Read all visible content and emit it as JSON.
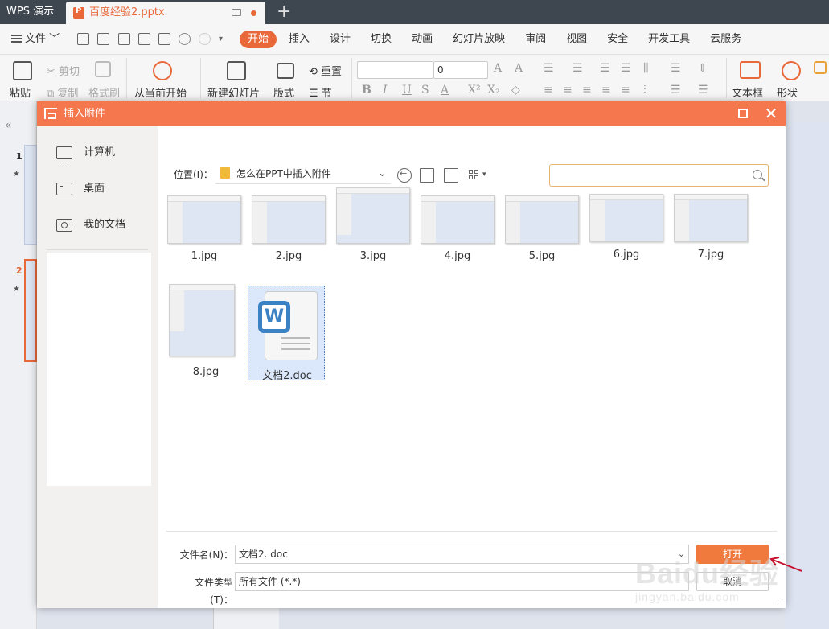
{
  "app": {
    "title": "WPS 演示",
    "doc_tab": "百度经验2.pptx"
  },
  "menu": {
    "file_label": "文件",
    "tabs": [
      {
        "label": "开始",
        "active": true
      },
      {
        "label": "插入"
      },
      {
        "label": "设计"
      },
      {
        "label": "切换"
      },
      {
        "label": "动画"
      },
      {
        "label": "幻灯片放映"
      },
      {
        "label": "审阅"
      },
      {
        "label": "视图"
      },
      {
        "label": "安全"
      },
      {
        "label": "开发工具"
      },
      {
        "label": "云服务"
      }
    ]
  },
  "ribbon": {
    "paste": "粘贴",
    "cut": "剪切",
    "copy": "复制",
    "format_painter": "格式刷",
    "from_current": "从当前开始",
    "new_slide": "新建幻灯片",
    "layout": "版式",
    "reset": "重置",
    "section": "节",
    "font_size": "0",
    "textbox": "文本框",
    "shape": "形状"
  },
  "slides": {
    "numbers": [
      "1",
      "2"
    ]
  },
  "dialog": {
    "title": "插入附件",
    "nav": [
      {
        "label": "计算机",
        "icon": "computer-icon"
      },
      {
        "label": "桌面",
        "icon": "desktop-icon"
      },
      {
        "label": "我的文档",
        "icon": "my-documents-icon"
      }
    ],
    "location_label": "位置(I)：",
    "location_path": "怎么在PPT中插入附件",
    "search_placeholder": "",
    "files": [
      {
        "name": "1.jpg",
        "type": "image"
      },
      {
        "name": "2.jpg",
        "type": "image"
      },
      {
        "name": "3.jpg",
        "type": "image"
      },
      {
        "name": "4.jpg",
        "type": "image"
      },
      {
        "name": "5.jpg",
        "type": "image"
      },
      {
        "name": "6.jpg",
        "type": "image"
      },
      {
        "name": "7.jpg",
        "type": "image"
      },
      {
        "name": "8.jpg",
        "type": "image"
      },
      {
        "name": "文档2.doc",
        "type": "word",
        "selected": true
      }
    ],
    "filename_label": "文件名(N)：",
    "filename_value": "文档2. doc",
    "filetype_label": "文件类型(T)：",
    "filetype_value": "所有文件 (*.*)",
    "open_button": "打开",
    "cancel_button": "取消"
  },
  "watermark": {
    "main": "Baidu经验",
    "sub": "jingyan.baidu.com"
  },
  "colors": {
    "accent": "#e9683a",
    "dialog_title": "#f4774e",
    "titlebar": "#3e4650",
    "word_blue": "#3b82c4"
  }
}
